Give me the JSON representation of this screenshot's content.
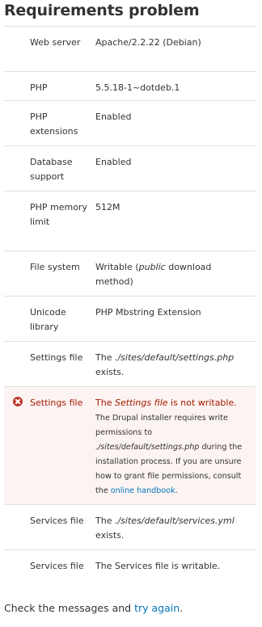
{
  "page": {
    "title": "Requirements problem"
  },
  "requirements": [
    {
      "label": "Web server",
      "value": "Apache/2.2.22 (Debian)"
    },
    {
      "label": "PHP",
      "value": "5.5.18-1~dotdeb.1"
    },
    {
      "label": "PHP extensions",
      "value": "Enabled"
    },
    {
      "label": "Database support",
      "value": "Enabled"
    },
    {
      "label": "PHP memory limit",
      "value": "512M"
    },
    {
      "label": "File system",
      "value_pre": "Writable (",
      "value_em": "public",
      "value_post": " download method)"
    },
    {
      "label": "Unicode library",
      "value": "PHP Mbstring Extension"
    },
    {
      "label": "Settings file",
      "value_pre": "The ",
      "value_em": "./sites/default/settings.php",
      "value_post": " exists."
    },
    {
      "label": "Settings file",
      "status": "error",
      "value_pre": "The ",
      "value_em": "Settings file",
      "value_post": " is not writable.",
      "desc_1": "The Drupal installer requires write permissions to ",
      "desc_path": "./sites/default/settings.php",
      "desc_2": " during the installation process. If you are unsure how to grant file permissions, consult the ",
      "desc_link": "online handbook",
      "desc_end": "."
    },
    {
      "label": "Services file",
      "value_pre": "The ",
      "value_em": "./sites/default/services.yml",
      "value_post": " exists."
    },
    {
      "label": "Services file",
      "value": "The Services file is writable."
    }
  ],
  "footer": {
    "text": "Check the messages and ",
    "link": "try again",
    "end": "."
  },
  "colors": {
    "error_text": "#a51b00",
    "error_bg": "#fcf4f2",
    "link": "#0074bd",
    "border": "#e0e0e0"
  },
  "icons": {
    "error": "error-circle-x-icon"
  }
}
